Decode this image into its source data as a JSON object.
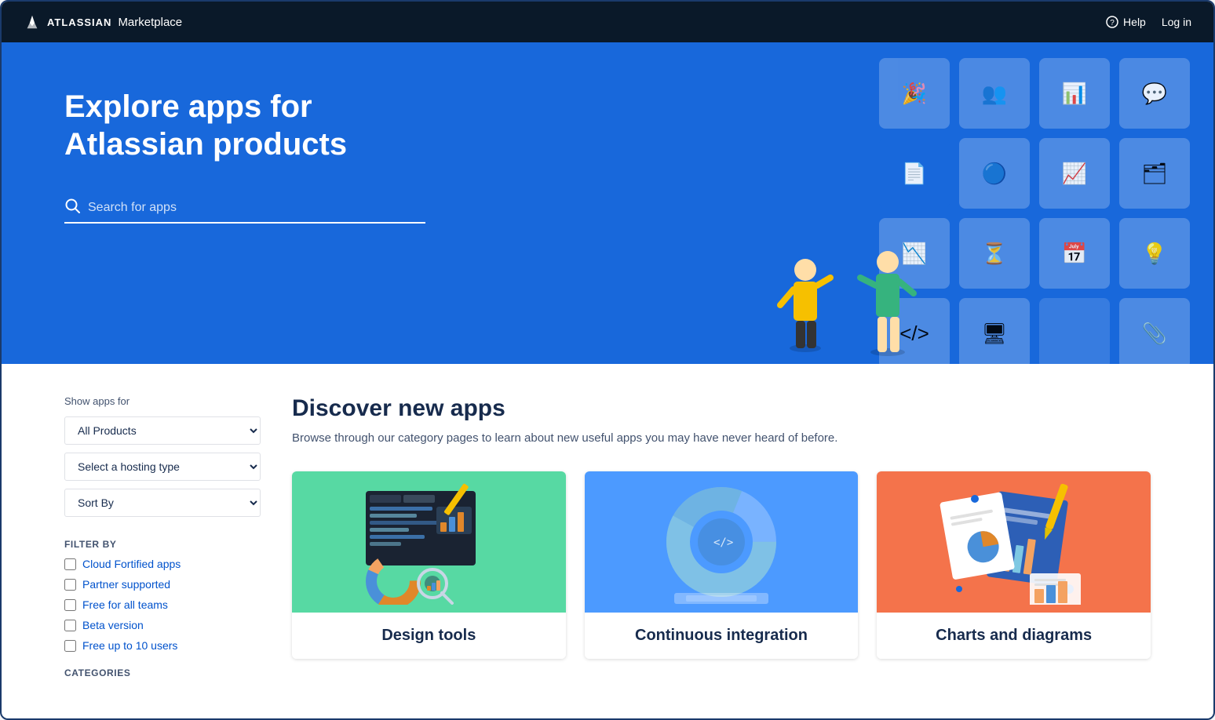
{
  "nav": {
    "brand": "ATLASSIAN",
    "product": "Marketplace",
    "help_label": "Help",
    "login_label": "Log in"
  },
  "hero": {
    "title": "Explore apps for Atlassian products",
    "search_placeholder": "Search for apps"
  },
  "sidebar": {
    "show_apps_for_label": "Show apps for",
    "all_products_label": "All Products",
    "hosting_placeholder": "Select a hosting type",
    "sort_by_label": "Sort By",
    "filter_by_label": "FILTER BY",
    "filters": [
      {
        "id": "cloud-fortified",
        "label": "Cloud Fortified apps"
      },
      {
        "id": "partner-supported",
        "label": "Partner supported"
      },
      {
        "id": "free-for-all",
        "label": "Free for all teams"
      },
      {
        "id": "beta-version",
        "label": "Beta version"
      },
      {
        "id": "free-10-users",
        "label": "Free up to 10 users"
      }
    ],
    "categories_label": "CATEGORIES"
  },
  "main": {
    "discover_title": "Discover new apps",
    "discover_subtitle": "Browse through our category pages to learn about new useful apps you may have never heard of before.",
    "cards": [
      {
        "id": "design-tools",
        "label": "Design tools",
        "color": "green",
        "emoji": "🎨"
      },
      {
        "id": "continuous-integration",
        "label": "Continuous integration",
        "color": "blue",
        "emoji": "🔄"
      },
      {
        "id": "charts-diagrams",
        "label": "Charts and diagrams",
        "color": "orange",
        "emoji": "📊"
      }
    ]
  }
}
